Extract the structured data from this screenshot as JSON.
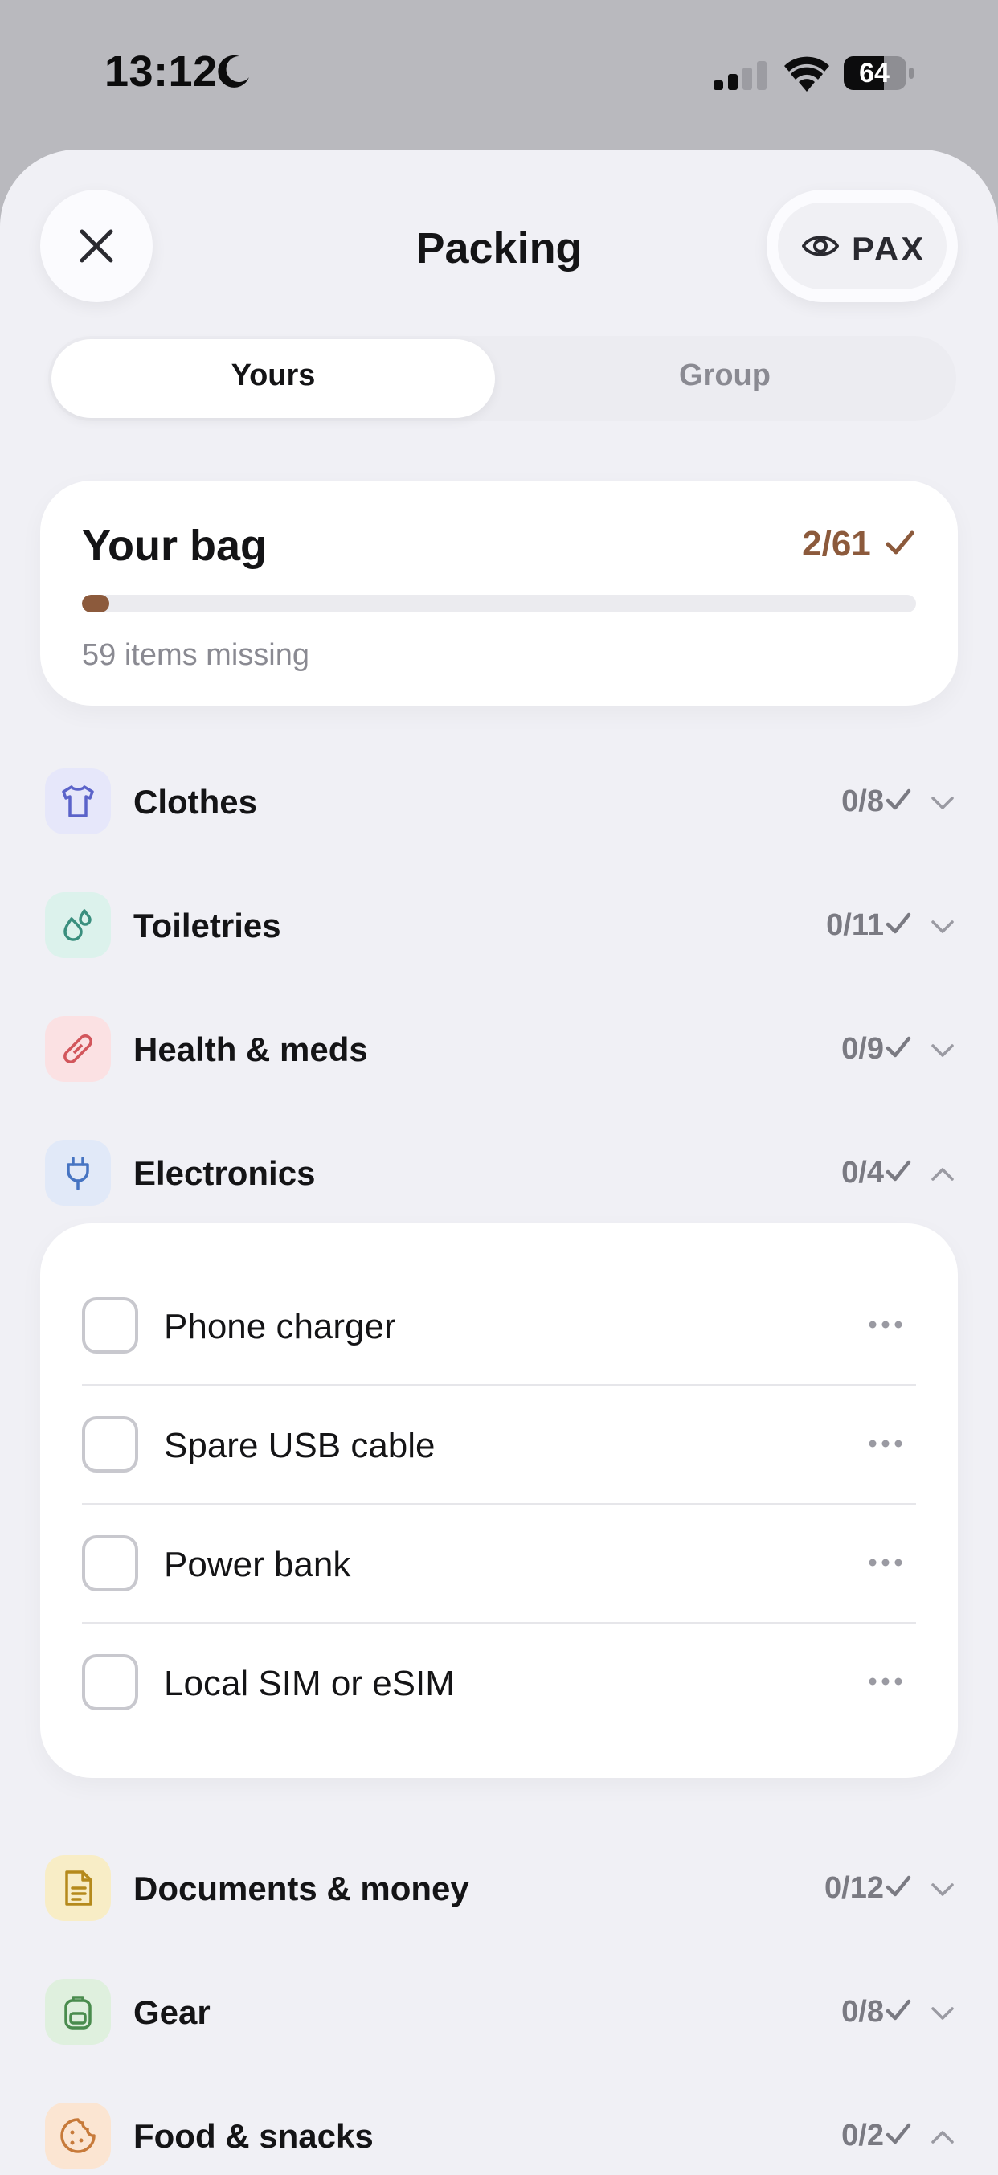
{
  "status_bar": {
    "time": "13:12",
    "battery": "64"
  },
  "header": {
    "title": "Packing",
    "pax_label": "PAX"
  },
  "tabs": [
    {
      "label": "Yours",
      "active": true
    },
    {
      "label": "Group",
      "active": false
    }
  ],
  "bag": {
    "title": "Your bag",
    "count": "2/61",
    "packed": 2,
    "total": 61,
    "missing_text": "59 items missing",
    "accent_color": "#8c5a3c"
  },
  "categories": [
    {
      "label": "Clothes",
      "count": "0/8",
      "icon": "shirt-icon",
      "color": "#5b63c9",
      "bg": "#e6e7fa",
      "expanded": false
    },
    {
      "label": "Toiletries",
      "count": "0/11",
      "icon": "droplets-icon",
      "color": "#3a8f7e",
      "bg": "#dcf2ec",
      "expanded": false
    },
    {
      "label": "Health & meds",
      "count": "0/9",
      "icon": "bandage-icon",
      "color": "#d2565c",
      "bg": "#fbe1e3",
      "expanded": false
    },
    {
      "label": "Electronics",
      "count": "0/4",
      "icon": "plug-icon",
      "color": "#4674c2",
      "bg": "#e1e9f8",
      "expanded": true
    },
    {
      "label": "Documents & money",
      "count": "0/12",
      "icon": "document-icon",
      "color": "#b58a1c",
      "bg": "#f8edc6",
      "expanded": false
    },
    {
      "label": "Gear",
      "count": "0/8",
      "icon": "backpack-icon",
      "color": "#4a8c4e",
      "bg": "#dff0de",
      "expanded": false
    },
    {
      "label": "Food & snacks",
      "count": "0/2",
      "icon": "cookie-icon",
      "color": "#c77a3a",
      "bg": "#fbe5d2",
      "expanded": true
    }
  ],
  "electronics_items": [
    {
      "label": "Phone charger",
      "checked": false
    },
    {
      "label": "Spare USB cable",
      "checked": false
    },
    {
      "label": "Power bank",
      "checked": false
    },
    {
      "label": "Local SIM or eSIM",
      "checked": false
    }
  ]
}
